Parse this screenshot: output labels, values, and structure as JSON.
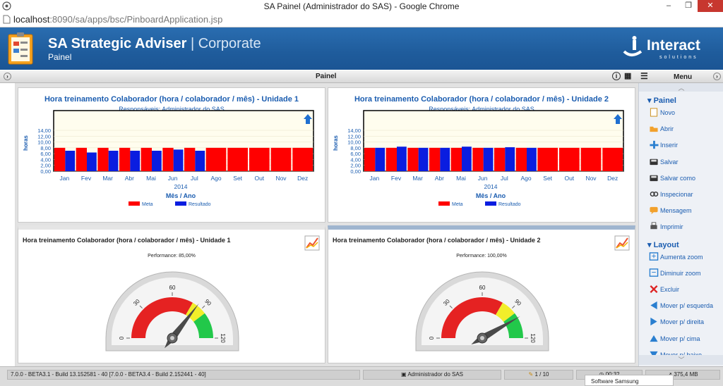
{
  "window": {
    "title": "SA Painel (Administrador do SAS) - Google Chrome"
  },
  "address": {
    "host": "localhost",
    "path": ":8090/sa/apps/bsc/PinboardApplication.jsp"
  },
  "header": {
    "title": "SA Strategic Adviser",
    "separator": "|",
    "edition": "Corporate",
    "subtitle": "Painel",
    "logo_text": "Interact",
    "logo_sub": "solutions"
  },
  "toolbar": {
    "title": "Painel",
    "menu_label": "Menu"
  },
  "charts": [
    {
      "title": "Hora treinamento Colaborador (hora / colaborador / mês) - Unidade 1",
      "responsible": "Responsáveis: Administrador do SAS",
      "year": "2014",
      "xlabel": "Mês / Ano",
      "ylabel": "horas",
      "legend": [
        "Meta",
        "Resultado"
      ]
    },
    {
      "title": "Hora treinamento Colaborador (hora / colaborador / mês) - Unidade 2",
      "responsible": "Responsáveis: Administrador do SAS",
      "year": "2014",
      "xlabel": "Mês / Ano",
      "ylabel": "horas",
      "legend": [
        "Meta",
        "Resultado"
      ]
    }
  ],
  "chart_data": [
    {
      "type": "bar",
      "categories": [
        "Jan",
        "Fev",
        "Mar",
        "Abr",
        "Mai",
        "Jun",
        "Jul",
        "Ago",
        "Set",
        "Out",
        "Nov",
        "Dez"
      ],
      "yticks": [
        "14,00",
        "12,00",
        "10,00",
        "8,00",
        "6,00",
        "4,00",
        "2,00",
        "0,00"
      ],
      "ylim": [
        0,
        14
      ],
      "series": [
        {
          "name": "Meta",
          "values": [
            8,
            8,
            8,
            8,
            8,
            8,
            8,
            8,
            8,
            8,
            8,
            8
          ]
        },
        {
          "name": "Resultado",
          "values": [
            7,
            6.4,
            7,
            7,
            7,
            7.4,
            7,
            null,
            null,
            null,
            null,
            null
          ]
        }
      ],
      "colors": [
        "#ff0000",
        "#0a1de0"
      ]
    },
    {
      "type": "bar",
      "categories": [
        "Jan",
        "Fev",
        "Mar",
        "Abr",
        "Mai",
        "Jun",
        "Jul",
        "Ago",
        "Set",
        "Out",
        "Nov",
        "Dez"
      ],
      "yticks": [
        "14,00",
        "12,00",
        "10,00",
        "8,00",
        "6,00",
        "4,00",
        "2,00",
        "0,00"
      ],
      "ylim": [
        0,
        14
      ],
      "series": [
        {
          "name": "Meta",
          "values": [
            8,
            8,
            8,
            8,
            8,
            8,
            8,
            8,
            8,
            8,
            8,
            8
          ]
        },
        {
          "name": "Resultado",
          "values": [
            8,
            8.4,
            8,
            8,
            8.4,
            8,
            8.2,
            8,
            null,
            null,
            null,
            null
          ]
        }
      ],
      "colors": [
        "#ff0000",
        "#0a1de0"
      ]
    }
  ],
  "gauges": [
    {
      "title": "Hora treinamento Colaborador (hora / colaborador / mês) - Unidade 1",
      "performance_label": "Performance: 85,00%",
      "performance": 85,
      "ticks": [
        "0",
        "30",
        "60",
        "90",
        "120"
      ]
    },
    {
      "title": "Hora treinamento Colaborador (hora / colaborador / mês) - Unidade 2",
      "performance_label": "Performance: 100,00%",
      "performance": 100,
      "ticks": [
        "0",
        "30",
        "60",
        "90",
        "120"
      ]
    }
  ],
  "menu": {
    "sections": [
      {
        "title": "Painel",
        "items": [
          "Novo",
          "Abrir",
          "Inserir",
          "Salvar",
          "Salvar como",
          "Inspecionar",
          "Mensagem",
          "Imprimir"
        ]
      },
      {
        "title": "Layout",
        "items": [
          "Aumenta zoom",
          "Diminuir zoom",
          "Excluir",
          "Mover p/ esquerda",
          "Mover p/ direita",
          "Mover p/ cima",
          "Mover p/ baixo"
        ]
      }
    ]
  },
  "status": {
    "version": "7.0.0 - BETA3.1 - Build 13.152581 - 40 [7.0.0 - BETA3.4 - Build 2.152441 - 40]",
    "user": "Administrador do SAS",
    "pages": "1 / 10",
    "time": "00:32",
    "memory": "375,4 MB",
    "tooltip": "Software Samsung"
  }
}
